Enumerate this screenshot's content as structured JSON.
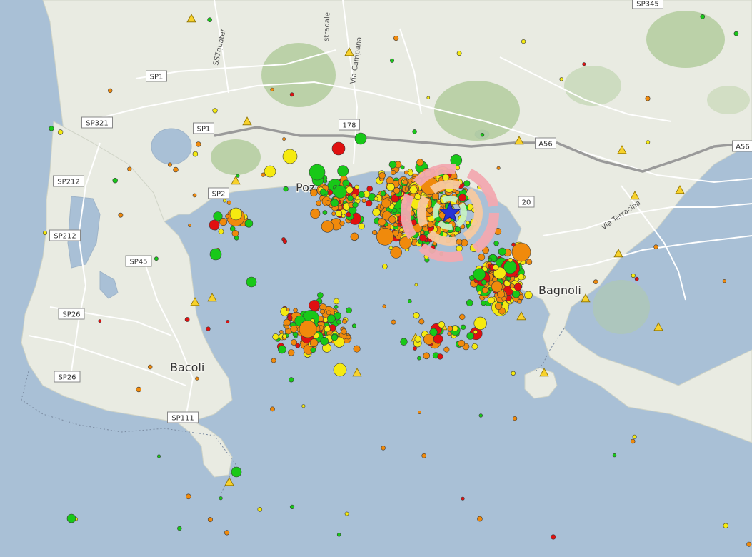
{
  "map": {
    "places": [
      {
        "name": "Bacoli"
      },
      {
        "name": "Bagnoli"
      },
      {
        "name": "Pozz"
      }
    ],
    "road_shields": [
      "SP1",
      "SP1",
      "SP321",
      "SP212",
      "SP212",
      "SP45",
      "SP26",
      "SP26",
      "SP111",
      "SP2",
      "178",
      "A56",
      "A56",
      "SP345",
      "20"
    ],
    "street_names": [
      "SS7quater",
      "Via Campana",
      "stradale",
      "Via Terracina"
    ],
    "colors": {
      "sea": "#a9c0d6",
      "land": "#e9ebe2",
      "hill_green": "#b3cd9e",
      "road": "#ffffff",
      "motorway": "#9a9a9a",
      "event_red": "#e01010",
      "event_orange": "#f08a0c",
      "event_yellow": "#f5ea10",
      "event_green": "#18c818",
      "station_triangle": "#f7d12b",
      "epicenter_star": "#2733d6",
      "ring_pink": "#f2a9b0",
      "ring_peach": "#f6c9a0",
      "ring_green": "#c6f0c4"
    },
    "legend_icons": {
      "epicenter": "star-icon",
      "station": "triangle-icon",
      "event": "circle-icon"
    }
  }
}
